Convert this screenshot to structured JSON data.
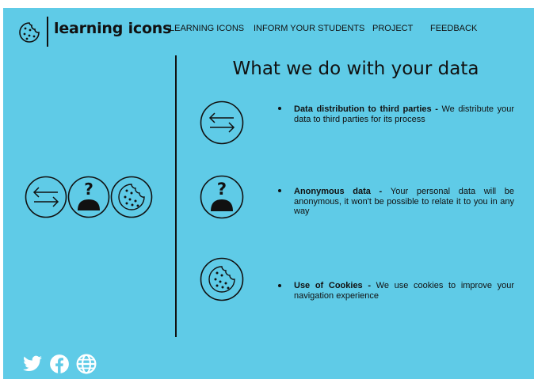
{
  "header": {
    "brand": "learning icons",
    "nav": [
      {
        "label": "LEARNING ICONS"
      },
      {
        "label": "INFORM YOUR STUDENTS"
      },
      {
        "label": "PROJECT"
      },
      {
        "label": "FEEDBACK"
      }
    ]
  },
  "main": {
    "heading": "What we do with your data",
    "items": [
      {
        "icon": "arrows-exchange-icon",
        "title": "Data distribution to third parties",
        "separator": " - ",
        "text": "We distribute your data to third parties for its process"
      },
      {
        "icon": "anonymous-person-icon",
        "title": "Anonymous data",
        "separator": " - ",
        "text": "Your personal data will be anonymous, it won't be possible to relate it to you in any way"
      },
      {
        "icon": "cookie-icon",
        "title": "Use of Cookies",
        "separator": " - ",
        "text": "We use cookies to improve your navigation experience"
      }
    ]
  },
  "left_panel": {
    "icons": [
      "arrows-exchange-icon",
      "anonymous-person-icon",
      "cookie-icon"
    ]
  },
  "footer": {
    "social": [
      "twitter-icon",
      "facebook-icon",
      "globe-icon"
    ]
  },
  "colors": {
    "background": "#5fcbe7",
    "ink": "#111111"
  }
}
